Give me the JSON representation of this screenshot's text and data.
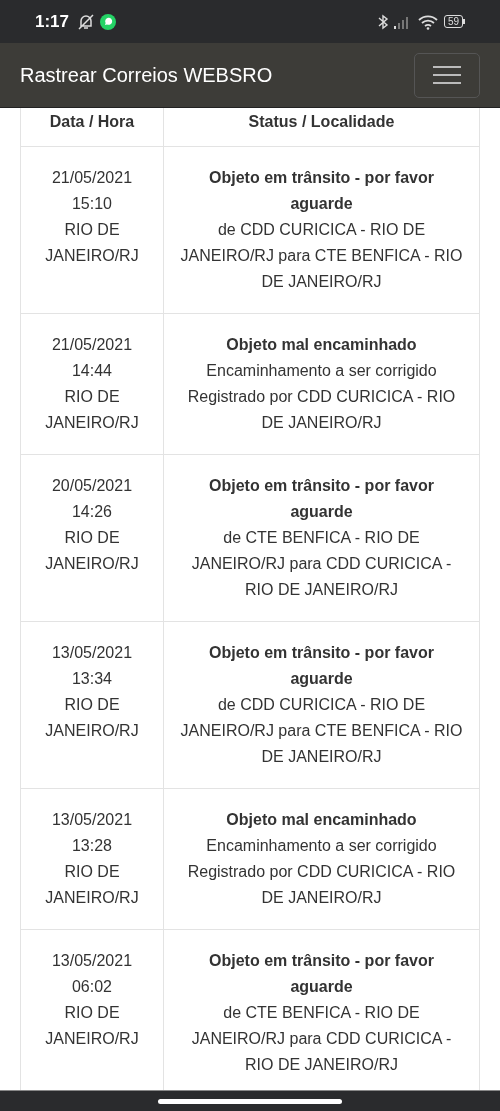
{
  "status_bar": {
    "time": "1:17",
    "battery": "59"
  },
  "app_bar": {
    "title": "Rastrear Correios WEBSRO"
  },
  "table": {
    "columns": [
      "Data / Hora",
      "Status / Localidade"
    ],
    "rows": [
      {
        "date": "21/05/2021",
        "time": "15:10",
        "place": "RIO DE JANEIRO/RJ",
        "status": "Objeto em trânsito - por favor aguarde",
        "details": [
          "de CDD CURICICA - RIO DE JANEIRO/RJ para CTE BENFICA - RIO DE JANEIRO/RJ"
        ]
      },
      {
        "date": "21/05/2021",
        "time": "14:44",
        "place": "RIO DE JANEIRO/RJ",
        "status": "Objeto mal encaminhado",
        "details": [
          "Encaminhamento a ser corrigido",
          "Registrado por CDD CURICICA - RIO DE JANEIRO/RJ"
        ]
      },
      {
        "date": "20/05/2021",
        "time": "14:26",
        "place": "RIO DE JANEIRO/RJ",
        "status": "Objeto em trânsito - por favor aguarde",
        "details": [
          "de CTE BENFICA - RIO DE JANEIRO/RJ para CDD CURICICA - RIO DE JANEIRO/RJ"
        ]
      },
      {
        "date": "13/05/2021",
        "time": "13:34",
        "place": "RIO DE JANEIRO/RJ",
        "status": "Objeto em trânsito - por favor aguarde",
        "details": [
          "de CDD CURICICA - RIO DE JANEIRO/RJ para CTE BENFICA - RIO DE JANEIRO/RJ"
        ]
      },
      {
        "date": "13/05/2021",
        "time": "13:28",
        "place": "RIO DE JANEIRO/RJ",
        "status": "Objeto mal encaminhado",
        "details": [
          "Encaminhamento a ser corrigido",
          "Registrado por CDD CURICICA - RIO DE JANEIRO/RJ"
        ]
      },
      {
        "date": "13/05/2021",
        "time": "06:02",
        "place": "RIO DE JANEIRO/RJ",
        "status": "Objeto em trânsito - por favor aguarde",
        "details": [
          "de CTE BENFICA - RIO DE JANEIRO/RJ para CDD CURICICA - RIO DE JANEIRO/RJ"
        ]
      }
    ]
  }
}
